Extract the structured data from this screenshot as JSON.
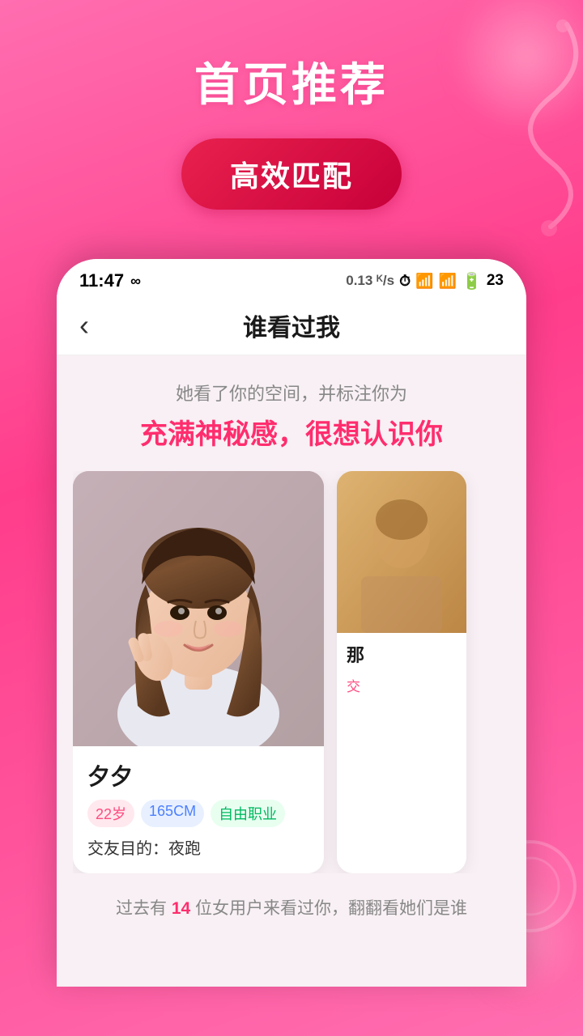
{
  "app": {
    "title": "首页推荐",
    "badge": "高效匹配"
  },
  "status_bar": {
    "time": "11:47",
    "network_indicator": "∞",
    "speed": "0.13 ᴷ/s",
    "battery": "23",
    "battery_icon": "🔋"
  },
  "nav": {
    "back_icon": "‹",
    "title": "谁看过我"
  },
  "content": {
    "subtitle": "她看了你的空间，并标注你为",
    "highlight": "充满神秘感，很想认识你",
    "profile": {
      "name": "夕夕",
      "tags": [
        {
          "label": "22岁",
          "type": "age"
        },
        {
          "label": "165CM",
          "type": "height"
        },
        {
          "label": "自由职业",
          "type": "job"
        }
      ],
      "purpose_label": "交友目的：",
      "purpose_value": "夜跑"
    },
    "peek": {
      "name": "那",
      "sub_text": "交"
    },
    "footer": {
      "prefix": "过去有 ",
      "count": "14",
      "suffix": " 位女用户来看过你，翻翻看她们是谁"
    }
  },
  "colors": {
    "primary_pink": "#ff3d8b",
    "deep_pink": "#ff2d6e",
    "dark_red": "#c8003a",
    "tag_age_bg": "#ffe8ee",
    "tag_age_text": "#ff4d80",
    "tag_height_bg": "#e8f0ff",
    "tag_height_text": "#4d80ff",
    "tag_job_bg": "#e8fff0",
    "tag_job_text": "#00b860"
  }
}
